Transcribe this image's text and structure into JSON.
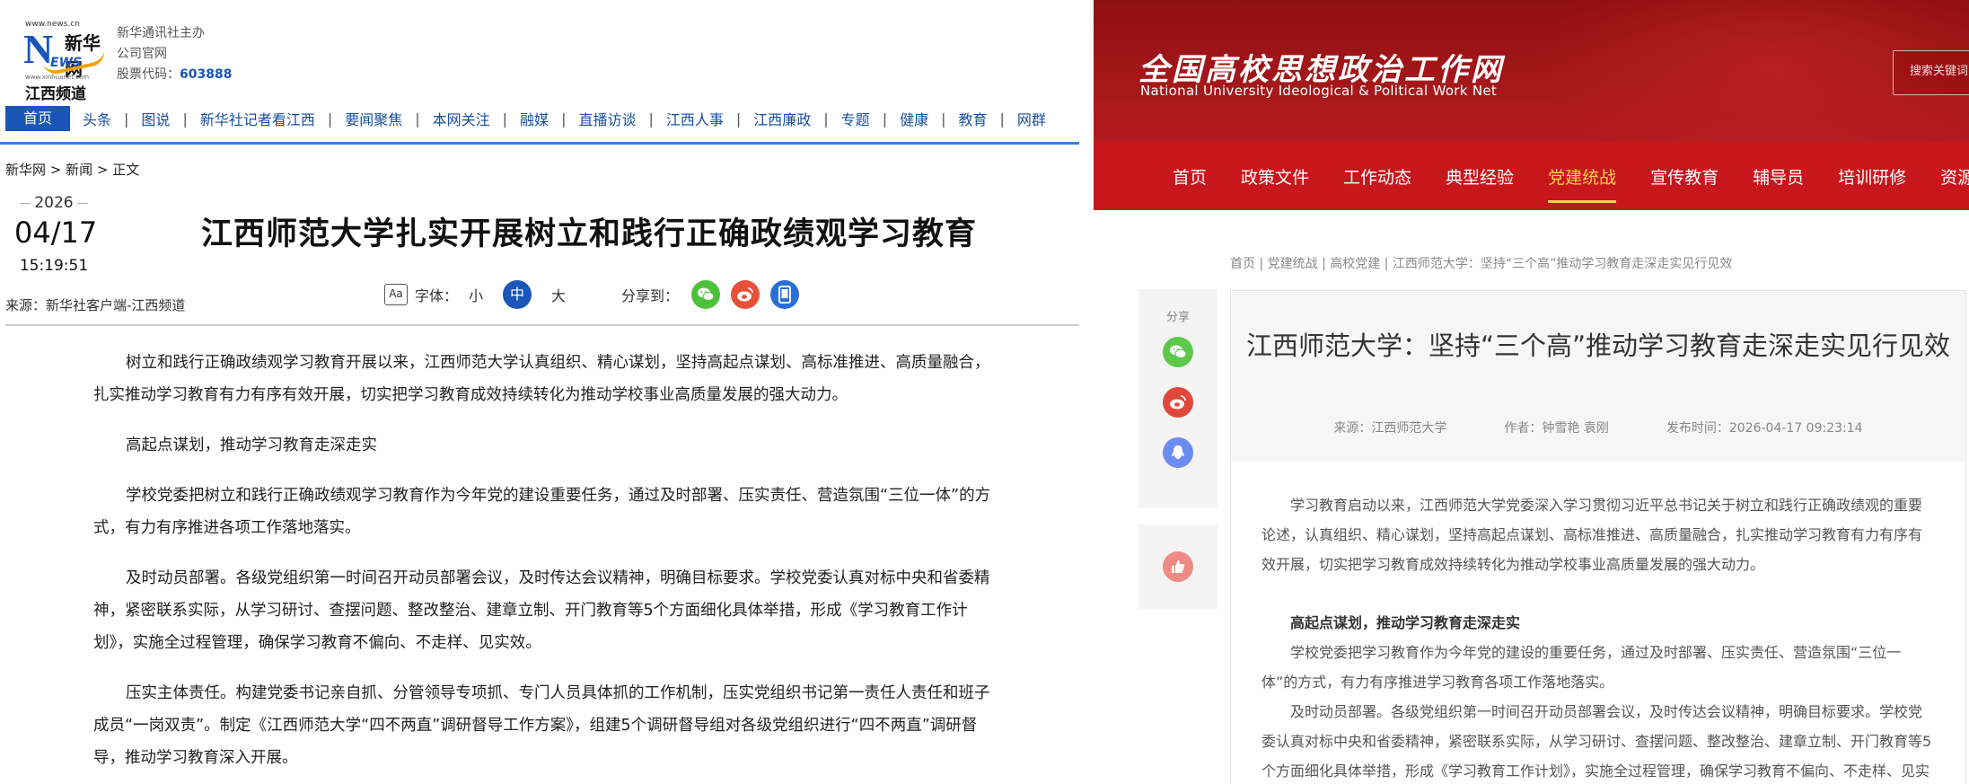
{
  "left": {
    "logo": {
      "url_text": "www.news.cn",
      "brand_cn": "新华网",
      "brand_en": "NEWS",
      "small_text": "www.xinhuanet.com",
      "channel": "江西频道"
    },
    "meta": {
      "line1": "新华通讯社主办",
      "line2": "公司官网",
      "stock_label": "股票代码：",
      "stock_code": "603888"
    },
    "nav": [
      "首页",
      "头条",
      "图说",
      "新华社记者看江西",
      "要闻聚焦",
      "本网关注",
      "融媒",
      "直播访谈",
      "江西人事",
      "江西廉政",
      "专题",
      "健康",
      "教育",
      "网群"
    ],
    "breadcrumb": "新华网 > 新闻 > 正文",
    "date": {
      "year": "2026",
      "month_day": "04/17",
      "time": "15:19:51"
    },
    "source": "来源：新华社客户端-江西频道",
    "title": "江西师范大学扎实开展树立和践行正确政绩观学习教育",
    "tools": {
      "font_icon": "Aa",
      "font_label": "字体：",
      "small": "小",
      "medium": "中",
      "large": "大",
      "share_label": "分享到："
    },
    "paragraphs": [
      "树立和践行正确政绩观学习教育开展以来，江西师范大学认真组织、精心谋划，坚持高起点谋划、高标准推进、高质量融合，扎实推动学习教育有力有序有效开展，切实把学习教育成效持续转化为推动学校事业高质量发展的强大动力。",
      "高起点谋划，推动学习教育走深走实",
      "学校党委把树立和践行正确政绩观学习教育作为今年党的建设重要任务，通过及时部署、压实责任、营造氛围“三位一体”的方式，有力有序推进各项工作落地落实。",
      "及时动员部署。各级党组织第一时间召开动员部署会议，及时传达会议精神，明确目标要求。学校党委认真对标中央和省委精神，紧密联系实际，从学习研讨、查摆问题、整改整治、建章立制、开门教育等5个方面细化具体举措，形成《学习教育工作计划》，实施全过程管理，确保学习教育不偏向、不走样、见实效。",
      "压实主体责任。构建党委书记亲自抓、分管领导专项抓、专门人员具体抓的工作机制，压实党组织书记第一责任人责任和班子成员“一岗双责”。制定《江西师范大学“四不两直”调研督导工作方案》，组建5个调研督导组对各级党组织进行“四不两直”调研督导，推动学习教育深入开展。"
    ]
  },
  "right": {
    "logo_cn": "全国高校思想政治工作网",
    "logo_en": "National University Ideological & Political Work Net",
    "search_placeholder": "搜索关键词",
    "nav": [
      "首页",
      "政策文件",
      "工作动态",
      "典型经验",
      "党建统战",
      "宣传教育",
      "辅导员",
      "培训研修",
      "资源"
    ],
    "nav_active": "党建统战",
    "breadcrumb": "首页 | 党建统战 | 高校党建 | 江西师范大学：坚持“三个高”推动学习教育走深走实见行见效",
    "share_label": "分享",
    "title": "江西师范大学：坚持“三个高”推动学习教育走深走实见行见效",
    "meta": {
      "source": "来源：江西师范大学",
      "author": "作者：钟雪艳 袁刚",
      "published": "发布时间：2026-04-17 09:23:14"
    },
    "lead": "学习教育启动以来，江西师范大学党委深入学习贯彻习近平总书记关于树立和践行正确政绩观的重要论述，认真组织、精心谋划，坚持高起点谋划、高标准推进、高质量融合，扎实推动学习教育有力有序有效开展，切实把学习教育成效持续转化为推动学校事业高质量发展的强大动力。",
    "section_heading": "高起点谋划，推动学习教育走深走实",
    "paragraphs": [
      "学校党委把学习教育作为今年党的建设的重要任务，通过及时部署、压实责任、营造氛围“三位一体”的方式，有力有序推进学习教育各项工作落地落实。",
      "及时动员部署。各级党组织第一时间召开动员部署会议，及时传达会议精神，明确目标要求。学校党委认真对标中央和省委精神，紧密联系实际，从学习研讨、查摆问题、整改整治、建章立制、开门教育等5个方面细化具体举措，形成《学习教育工作计划》，实施全过程管理，确保学习教育不偏向、不走样、见实效。"
    ]
  }
}
